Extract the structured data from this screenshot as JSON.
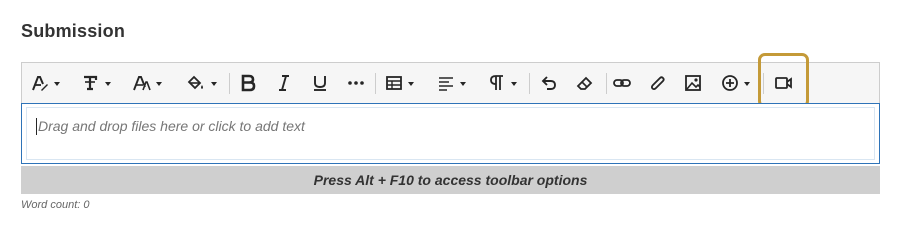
{
  "section": {
    "title": "Submission"
  },
  "toolbar": {
    "buttons": [
      {
        "icon": "text-style-icon",
        "dropdown": true
      },
      {
        "icon": "paragraph-format-icon",
        "dropdown": true
      },
      {
        "icon": "font-size-icon",
        "dropdown": true
      },
      {
        "icon": "fill-color-icon",
        "dropdown": true
      },
      {
        "icon": "bold-icon",
        "dropdown": false
      },
      {
        "icon": "italic-icon",
        "dropdown": false
      },
      {
        "icon": "underline-icon",
        "dropdown": false
      },
      {
        "icon": "more-options-icon",
        "dropdown": false
      },
      {
        "icon": "table-icon",
        "dropdown": true
      },
      {
        "icon": "align-icon",
        "dropdown": true
      },
      {
        "icon": "pilcrow-icon",
        "dropdown": true
      },
      {
        "icon": "undo-icon",
        "dropdown": false
      },
      {
        "icon": "eraser-icon",
        "dropdown": false
      },
      {
        "icon": "link-icon",
        "dropdown": false
      },
      {
        "icon": "attachment-icon",
        "dropdown": false
      },
      {
        "icon": "image-icon",
        "dropdown": false
      },
      {
        "icon": "insert-content-icon",
        "dropdown": true
      },
      {
        "icon": "video-camera-icon",
        "dropdown": false,
        "highlighted": true
      }
    ],
    "highlight_color": "#c49a38"
  },
  "editor": {
    "placeholder": "Drag and drop files here or click to add text",
    "border_color": "#2e73b8"
  },
  "hint_bar": {
    "text": "Press Alt + F10 to access toolbar options"
  },
  "word_count": {
    "label": "Word count: 0"
  }
}
